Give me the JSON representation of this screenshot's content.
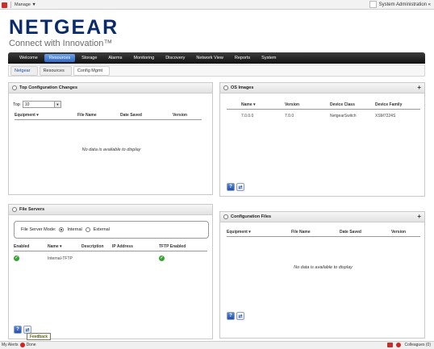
{
  "topbar": {
    "manage_label": "Manage ▼",
    "user": "System Administration «"
  },
  "logo": {
    "brand": "NETGEAR",
    "tagline": "Connect with Innovation™"
  },
  "nav": {
    "tabs": [
      "Welcome",
      "Resources",
      "Storage",
      "Alarms",
      "Monitoring",
      "Discovery",
      "Network View",
      "Reports",
      "System"
    ],
    "active": "Resources"
  },
  "breadcrumb": [
    "Netgear",
    "Resources",
    "Config Mgmt"
  ],
  "top_config": {
    "title": "Top Configuration Changes",
    "top_label": "Top",
    "top_value": "10",
    "columns": [
      "Equipment ▾",
      "File Name",
      "Date Saved",
      "Version"
    ],
    "empty": "No data is available to display"
  },
  "os_images": {
    "title": "OS Images",
    "columns": [
      "Name ▾",
      "Version",
      "Device Class",
      "Device Family"
    ],
    "rows": [
      [
        "7.0.0.0",
        "7.0.0",
        "NetgearSwitch",
        "XSM7224S"
      ]
    ]
  },
  "file_servers": {
    "title": "File Servers",
    "mode_label": "File Server Mode:",
    "mode_options": [
      "Internal",
      "External"
    ],
    "mode_selected": "Internal",
    "columns": [
      "Enabled",
      "Name ▾",
      "Description",
      "IP Address",
      "TFTP Enabled"
    ],
    "rows": [
      [
        "",
        "Internal-TFTP",
        "",
        "",
        ""
      ]
    ]
  },
  "config_files": {
    "title": "Configuration Files",
    "columns": [
      "Equipment ▾",
      "File Name",
      "Date Saved",
      "Version"
    ],
    "empty": "No data is available to display"
  },
  "status": {
    "left": "My Alerts",
    "left2": "Done",
    "right": "Colleagues (0)",
    "feedback": "Feedback"
  }
}
